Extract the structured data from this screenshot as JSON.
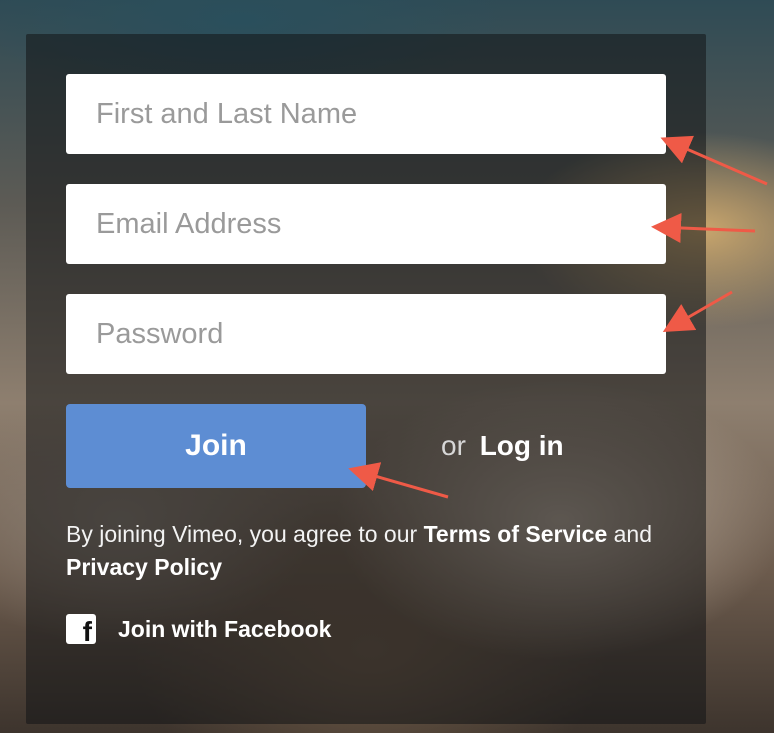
{
  "form": {
    "name_placeholder": "First and Last Name",
    "email_placeholder": "Email Address",
    "password_placeholder": "Password"
  },
  "actions": {
    "join_label": "Join",
    "or_text": "or",
    "login_label": "Log in"
  },
  "legal": {
    "prefix": "By joining Vimeo, you agree to our ",
    "terms_label": "Terms of Service",
    "and_text": " and ",
    "privacy_label": "Privacy Policy"
  },
  "social": {
    "facebook_label": "Join with Facebook"
  },
  "colors": {
    "join_button": "#5d8dd3",
    "annotation_arrows": "#ef5a47",
    "panel_overlay": "rgba(18, 20, 22, 0.55)"
  },
  "icons": {
    "facebook": "facebook-icon"
  }
}
